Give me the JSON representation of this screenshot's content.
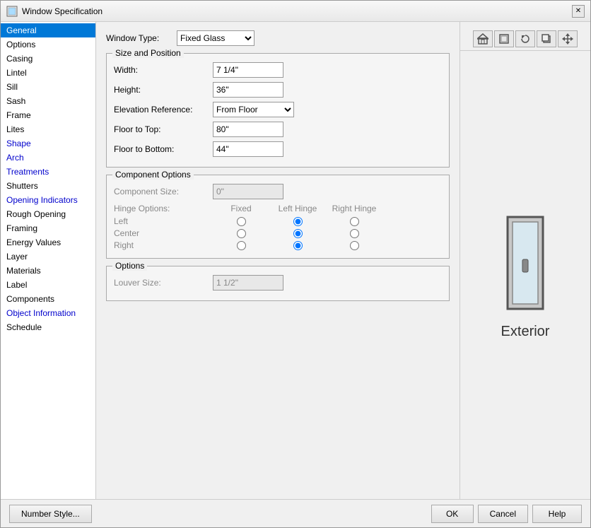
{
  "dialog": {
    "title": "Window Specification",
    "close_label": "✕"
  },
  "sidebar": {
    "items": [
      {
        "label": "General",
        "active": true,
        "colored": false
      },
      {
        "label": "Options",
        "active": false,
        "colored": false
      },
      {
        "label": "Casing",
        "active": false,
        "colored": false
      },
      {
        "label": "Lintel",
        "active": false,
        "colored": false
      },
      {
        "label": "Sill",
        "active": false,
        "colored": false
      },
      {
        "label": "Sash",
        "active": false,
        "colored": false
      },
      {
        "label": "Frame",
        "active": false,
        "colored": false
      },
      {
        "label": "Lites",
        "active": false,
        "colored": false
      },
      {
        "label": "Shape",
        "active": false,
        "colored": true
      },
      {
        "label": "Arch",
        "active": false,
        "colored": true
      },
      {
        "label": "Treatments",
        "active": false,
        "colored": true
      },
      {
        "label": "Shutters",
        "active": false,
        "colored": false
      },
      {
        "label": "Opening Indicators",
        "active": false,
        "colored": true
      },
      {
        "label": "Rough Opening",
        "active": false,
        "colored": false
      },
      {
        "label": "Framing",
        "active": false,
        "colored": false
      },
      {
        "label": "Energy Values",
        "active": false,
        "colored": false
      },
      {
        "label": "Layer",
        "active": false,
        "colored": false
      },
      {
        "label": "Materials",
        "active": false,
        "colored": false
      },
      {
        "label": "Label",
        "active": false,
        "colored": false
      },
      {
        "label": "Components",
        "active": false,
        "colored": false
      },
      {
        "label": "Object Information",
        "active": false,
        "colored": true
      },
      {
        "label": "Schedule",
        "active": false,
        "colored": false
      }
    ]
  },
  "form": {
    "window_type_label": "Window Type:",
    "window_type_value": "Fixed Glass",
    "size_position_title": "Size and Position",
    "width_label": "Width:",
    "width_value": "7 1/4\"",
    "height_label": "Height:",
    "height_value": "36\"",
    "elevation_ref_label": "Elevation Reference:",
    "elevation_ref_value": "From Floor",
    "floor_to_top_label": "Floor to Top:",
    "floor_to_top_value": "80\"",
    "floor_to_bottom_label": "Floor to Bottom:",
    "floor_to_bottom_value": "44\"",
    "component_options_title": "Component Options",
    "component_size_label": "Component Size:",
    "component_size_value": "0\"",
    "hinge_options_label": "Hinge Options:",
    "hinge_fixed": "Fixed",
    "hinge_left": "Left Hinge",
    "hinge_right": "Right Hinge",
    "hinge_left_label": "Left",
    "hinge_center_label": "Center",
    "hinge_right_label": "Right",
    "options_title": "Options",
    "louver_size_label": "Louver Size:",
    "louver_size_value": "1 1/2\""
  },
  "preview": {
    "toolbar_buttons": [
      "home",
      "frame",
      "rotate",
      "copy",
      "arrows"
    ],
    "exterior_label": "Exterior"
  },
  "footer": {
    "number_style_label": "Number Style...",
    "ok_label": "OK",
    "cancel_label": "Cancel",
    "help_label": "Help"
  }
}
